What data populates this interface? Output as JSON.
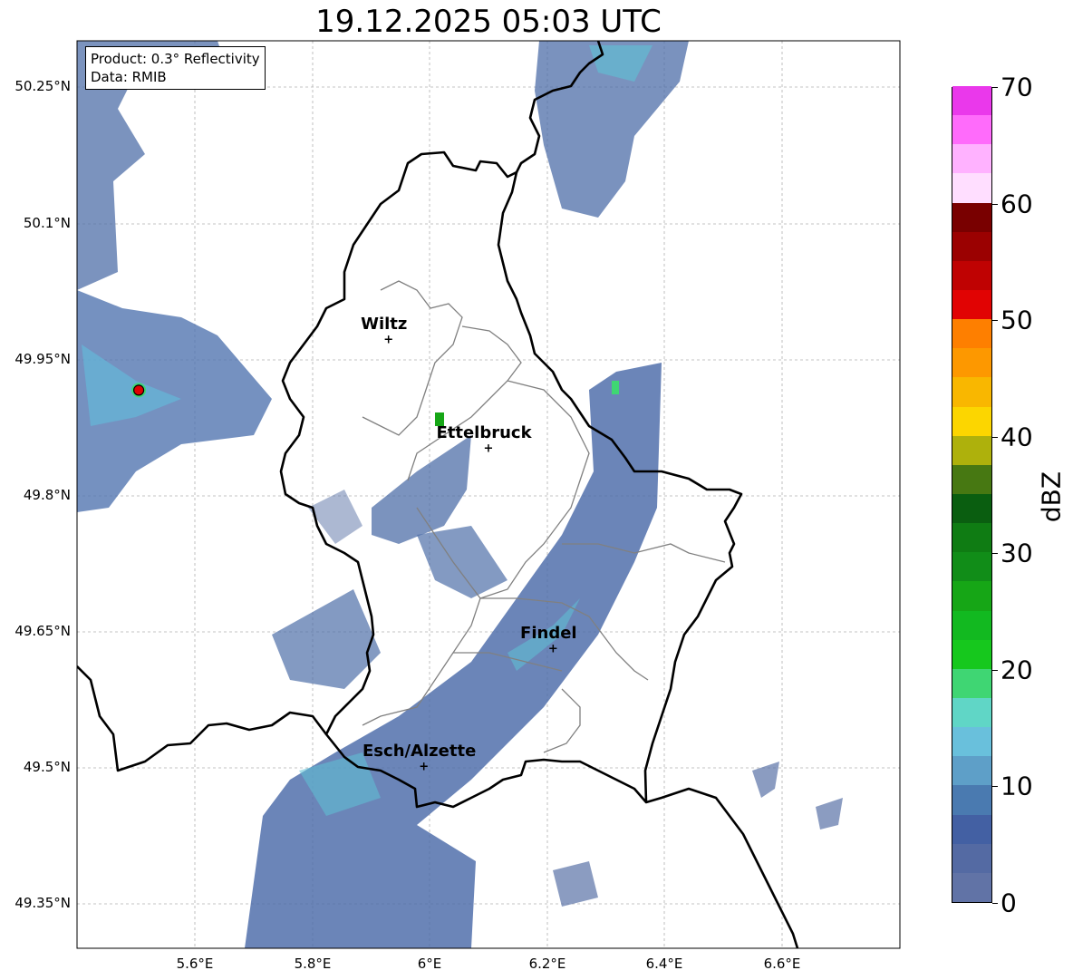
{
  "title": "19.12.2025 05:03 UTC",
  "info": {
    "product": "Product: 0.3° Reflectivity",
    "data": "Data: RMIB"
  },
  "axes": {
    "lat_ticks": [
      "50.25°N",
      "50.1°N",
      "49.95°N",
      "49.8°N",
      "49.65°N",
      "49.5°N",
      "49.35°N"
    ],
    "lon_ticks": [
      "5.6°E",
      "5.8°E",
      "6°E",
      "6.2°E",
      "6.4°E",
      "6.6°E"
    ]
  },
  "cities": [
    {
      "name": "Wiltz",
      "lon": 5.93,
      "lat": 49.97
    },
    {
      "name": "Ettelbruck",
      "lon": 6.1,
      "lat": 49.85
    },
    {
      "name": "Findel",
      "lon": 6.21,
      "lat": 49.63
    },
    {
      "name": "Esch/Alzette",
      "lon": 5.99,
      "lat": 49.5
    }
  ],
  "radar_site": {
    "lon": 5.505,
    "lat": 49.915
  },
  "colorbar": {
    "label": "dBZ",
    "ticks": [
      "0",
      "10",
      "20",
      "30",
      "40",
      "50",
      "60",
      "70"
    ],
    "min": 0,
    "max": 70,
    "step": 2.5,
    "colors": [
      "#6173a6",
      "#546aa3",
      "#4360a3",
      "#4a7ab0",
      "#5e9fc8",
      "#69c0dc",
      "#60d6c6",
      "#3fd673",
      "#16c81d",
      "#12b920",
      "#16a616",
      "#118d18",
      "#0f7c13",
      "#0a5e10",
      "#477812",
      "#aeb10c",
      "#fcd600",
      "#f9b700",
      "#fd9800",
      "#fe7f00",
      "#e10303",
      "#bf0202",
      "#9b0101",
      "#790000",
      "#ffdeff",
      "#ffb2ff",
      "#ff6bfb",
      "#ea38eb"
    ]
  }
}
